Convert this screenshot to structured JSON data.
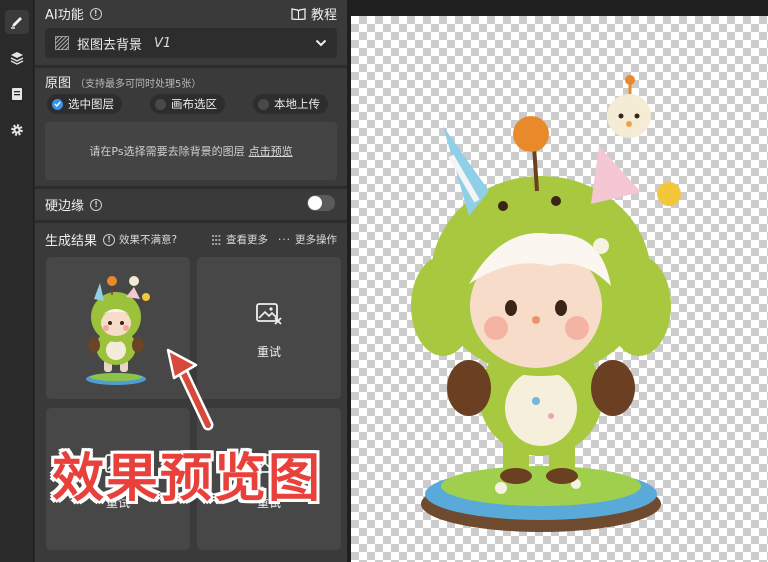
{
  "header": {
    "title": "AI功能",
    "tutorial_label": "教程"
  },
  "mode_select": {
    "value": "抠图去背景",
    "version": "V1"
  },
  "source": {
    "title": "原图",
    "hint": "（支持最多可同时处理5张）",
    "options": [
      {
        "label": "选中图层",
        "selected": true
      },
      {
        "label": "画布选区",
        "selected": false
      },
      {
        "label": "本地上传",
        "selected": false
      }
    ],
    "drop_text": "请在Ps选择需要去除背景的图层",
    "drop_link": "点击预览"
  },
  "hard_edge": {
    "label": "硬边缘",
    "enabled": false
  },
  "results": {
    "title": "生成结果",
    "unsatisfied_label": "效果不满意?",
    "view_more_label": "查看更多",
    "more_ops_label": "更多操作",
    "cards": [
      {
        "type": "image"
      },
      {
        "type": "retry",
        "label": "重试"
      },
      {
        "type": "retry",
        "label": "重试"
      },
      {
        "type": "retry",
        "label": "重试"
      }
    ]
  },
  "overlay_caption": "效果预览图",
  "colors": {
    "accent": "#3b93e8",
    "annotation_red": "#e8413c"
  },
  "icons": {
    "rail": [
      "brush-icon",
      "layers-icon",
      "document-icon",
      "gear-icon"
    ]
  }
}
